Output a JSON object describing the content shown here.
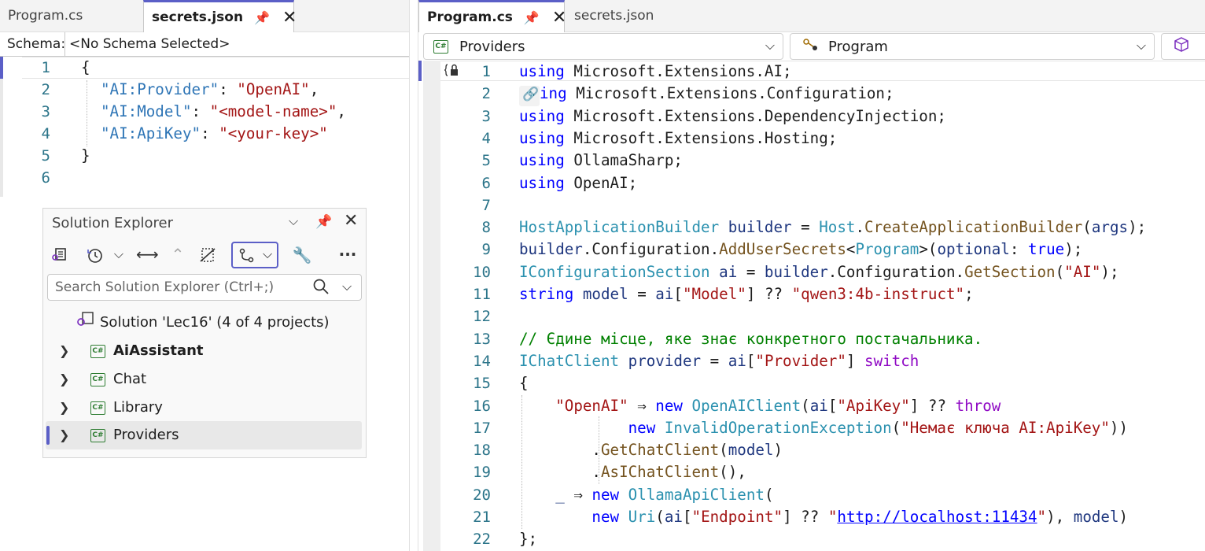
{
  "left_editor": {
    "tabs": [
      {
        "label": "Program.cs",
        "active": false
      },
      {
        "label": "secrets.json",
        "active": true
      }
    ],
    "schema": {
      "label": "Schema:",
      "value": "<No Schema Selected>"
    },
    "line_numbers": [
      "1",
      "2",
      "3",
      "4",
      "5",
      "6"
    ],
    "json_lines": [
      {
        "open": "{"
      },
      {
        "key": "\"AI:Provider\"",
        "sep": ": ",
        "value": "\"OpenAI\"",
        "end": ","
      },
      {
        "key": "\"AI:Model\"",
        "sep": ": ",
        "value": "\"<model-name>\"",
        "end": ","
      },
      {
        "key": "\"AI:ApiKey\"",
        "sep": ": ",
        "value": "\"<your-key>\"",
        "end": ""
      },
      {
        "close": "}"
      }
    ]
  },
  "solution_explorer": {
    "title": "Solution Explorer",
    "search_placeholder": "Search Solution Explorer (Ctrl+;)",
    "solution_label": "Solution 'Lec16' (4 of 4 projects)",
    "projects": [
      {
        "name": "AiAssistant",
        "bold": true,
        "selected": false
      },
      {
        "name": "Chat",
        "bold": false,
        "selected": false
      },
      {
        "name": "Library",
        "bold": false,
        "selected": false
      },
      {
        "name": "Providers",
        "bold": false,
        "selected": true
      }
    ],
    "more": "···"
  },
  "right_editor": {
    "tabs": [
      {
        "label": "Program.cs",
        "active": true
      },
      {
        "label": "secrets.json",
        "active": false
      }
    ],
    "nav": {
      "project": "Providers",
      "type": "Program"
    },
    "code": {
      "l1": [
        "using",
        " Microsoft.Extensions.AI;"
      ],
      "l2": [
        "ing",
        " Microsoft.Extensions.Configuration;"
      ],
      "l3": [
        "using",
        " Microsoft.Extensions.DependencyInjection;"
      ],
      "l4": [
        "using",
        " Microsoft.Extensions.Hosting;"
      ],
      "l5": [
        "using",
        " OllamaSharp;"
      ],
      "l6": [
        "using",
        " OpenAI;"
      ],
      "l8": [
        "HostApplicationBuilder",
        " ",
        "builder",
        " = ",
        "Host",
        ".",
        "CreateApplicationBuilder",
        "(",
        "args",
        ");"
      ],
      "l9": [
        "builder",
        ".Configuration.",
        "AddUserSecrets",
        "<",
        "Program",
        ">(",
        "optional",
        ": ",
        "true",
        ");"
      ],
      "l10": [
        "IConfigurationSection",
        " ",
        "ai",
        " = ",
        "builder",
        ".Configuration.",
        "GetSection",
        "(",
        "\"AI\"",
        ");"
      ],
      "l11": [
        "string",
        " ",
        "model",
        " = ",
        "ai",
        "[",
        "\"Model\"",
        "] ?? ",
        "\"qwen3:4b-instruct\"",
        ";"
      ],
      "l13": "// Єдине місце, яке знає конкретного постачальника.",
      "l14": [
        "IChatClient",
        " ",
        "provider",
        " = ",
        "ai",
        "[",
        "\"Provider\"",
        "] ",
        "switch"
      ],
      "l15": "{",
      "l16": [
        "    ",
        "\"OpenAI\"",
        " ⇒ ",
        "new",
        " ",
        "OpenAIClient",
        "(",
        "ai",
        "[",
        "\"ApiKey\"",
        "] ?? ",
        "throw"
      ],
      "l17": [
        "            ",
        "new",
        " ",
        "InvalidOperationException",
        "(",
        "\"Немає ключа AI:ApiKey\"",
        "))"
      ],
      "l18": [
        "        .",
        "GetChatClient",
        "(",
        "model",
        ")"
      ],
      "l19": [
        "        .",
        "AsIChatClient",
        "(),"
      ],
      "l20": [
        "    ",
        "_",
        " ⇒ ",
        "new",
        " ",
        "OllamaApiClient",
        "("
      ],
      "l21": [
        "        ",
        "new",
        " ",
        "Uri",
        "(",
        "ai",
        "[",
        "\"Endpoint\"",
        "] ?? ",
        "\"",
        "http://localhost:11434",
        "\"",
        "), ",
        "model",
        ")"
      ],
      "l22": "};"
    },
    "line_numbers": [
      "1",
      "2",
      "3",
      "4",
      "5",
      "6",
      "7",
      "8",
      "9",
      "10",
      "11",
      "12",
      "13",
      "14",
      "15",
      "16",
      "17",
      "18",
      "19",
      "20",
      "21",
      "22"
    ]
  },
  "colors": {
    "accent": "#5b5fc7",
    "keyword": "#0000ff",
    "type": "#2b91af",
    "string": "#a31515",
    "comment": "#008000"
  }
}
